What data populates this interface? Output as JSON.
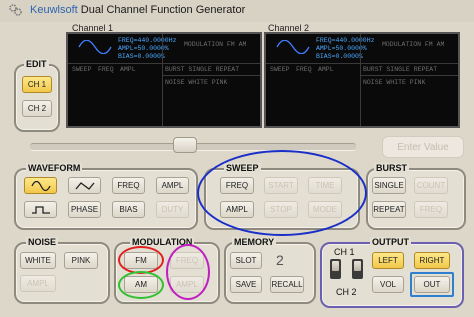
{
  "app": {
    "brand": "Keuwlsoft",
    "name": " Dual Channel Function Generator"
  },
  "edit": {
    "label": "EDIT",
    "ch1": "CH 1",
    "ch2": "CH 2"
  },
  "channels": [
    {
      "label": "Channel 1",
      "freq": "FREQ=440.0000Hz",
      "ampl": "AMPL=50.0000%",
      "bias": "BIAS=0.0000%",
      "row1": [
        "SWEEP",
        "FREQ",
        "AMPL"
      ],
      "mod_top": "MODULATION FM AM",
      "burst_row": "BURST  SINGLE REPEAT",
      "noise_row": "NOISE  WHITE  PINK"
    },
    {
      "label": "Channel 2",
      "freq": "FREQ=440.0000Hz",
      "ampl": "AMPL=50.0000%",
      "bias": "BIAS=0.0000%",
      "row1": [
        "SWEEP",
        "FREQ",
        "AMPL"
      ],
      "mod_top": "MODULATION FM AM",
      "burst_row": "BURST  SINGLE REPEAT",
      "noise_row": "NOISE  WHITE  PINK"
    }
  ],
  "enter_value": "Enter Value",
  "waveform": {
    "label": "WAVEFORM",
    "freq": "FREQ",
    "ampl": "AMPL",
    "phase": "PHASE",
    "bias": "BIAS",
    "duty": "DUTY"
  },
  "sweep": {
    "label": "SWEEP",
    "freq": "FREQ",
    "start": "START",
    "time": "TIME",
    "ampl": "AMPL",
    "stop": "STOP",
    "mode": "MODE"
  },
  "burst": {
    "label": "BURST",
    "single": "SINGLE",
    "count": "COUNT",
    "repeat": "REPEAT",
    "freq": "FREQ"
  },
  "noise": {
    "label": "NOISE",
    "white": "WHITE",
    "pink": "PINK",
    "ampl": "AMPL"
  },
  "modulation": {
    "label": "MODULATION",
    "fm": "FM",
    "freq": "FREQ",
    "am": "AM",
    "ampl": "AMPL"
  },
  "memory": {
    "label": "MEMORY",
    "slot": "SLOT",
    "slot_number": "2",
    "save": "SAVE",
    "recall": "RECALL"
  },
  "output": {
    "label": "OUTPUT",
    "ch1": "CH 1",
    "ch2": "CH 2",
    "toggle1": "L",
    "toggle2": "R",
    "left": "LEFT",
    "right": "RIGHT",
    "vol": "VOL",
    "out": "OUT"
  },
  "colors": {
    "active_button": "#f2c74a",
    "annotation_blue": "#1a2fc8",
    "annotation_red": "#e02020",
    "annotation_magenta": "#c020c0",
    "annotation_green": "#30c030",
    "output_panel": "#6b5fb0"
  }
}
